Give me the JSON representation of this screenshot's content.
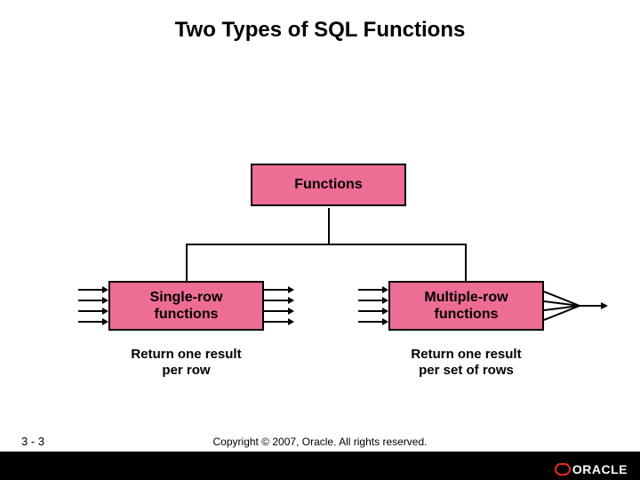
{
  "title": "Two Types of SQL Functions",
  "boxes": {
    "top": "Functions",
    "left_line1": "Single-row",
    "left_line2": "functions",
    "right_line1": "Multiple-row",
    "right_line2": "functions"
  },
  "captions": {
    "left_line1": "Return one result",
    "left_line2": "per row",
    "right_line1": "Return one result",
    "right_line2": "per set of rows"
  },
  "page": "3 - 3",
  "copyright": "Copyright © 2007, Oracle. All rights reserved.",
  "logo_text": "ORACLE"
}
